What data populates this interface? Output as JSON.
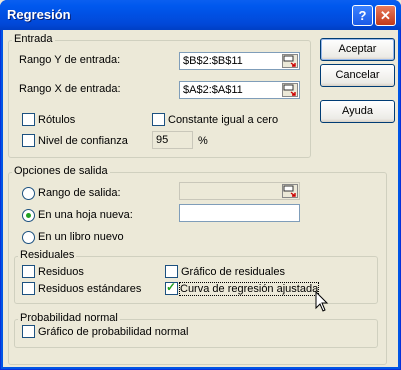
{
  "window": {
    "title": "Regresión",
    "help_label": "?",
    "close_label": "✕"
  },
  "buttons": {
    "ok": "Aceptar",
    "cancel": "Cancelar",
    "help": "Ayuda"
  },
  "entrada": {
    "group_label": "Entrada",
    "y_label": "Rango Y de entrada:",
    "y_value": "$B$2:$B$11",
    "x_label": "Rango X de entrada:",
    "x_value": "$A$2:$A$11",
    "rotulos": "Rótulos",
    "constante": "Constante igual a cero",
    "nivel": "Nivel de confianza",
    "nivel_value": "95",
    "nivel_unit": "%"
  },
  "salida": {
    "group_label": "Opciones de salida",
    "rango": "Rango de salida:",
    "hoja": "En una hoja nueva:",
    "libro": "En un libro nuevo"
  },
  "residuales": {
    "group_label": "Residuales",
    "residuos": "Residuos",
    "estandares": "Residuos estándares",
    "grafico": "Gráfico de residuales",
    "curva": "Curva de regresión ajustada"
  },
  "probabilidad": {
    "group_label": "Probabilidad normal",
    "grafico": "Gráfico de probabilidad normal"
  }
}
